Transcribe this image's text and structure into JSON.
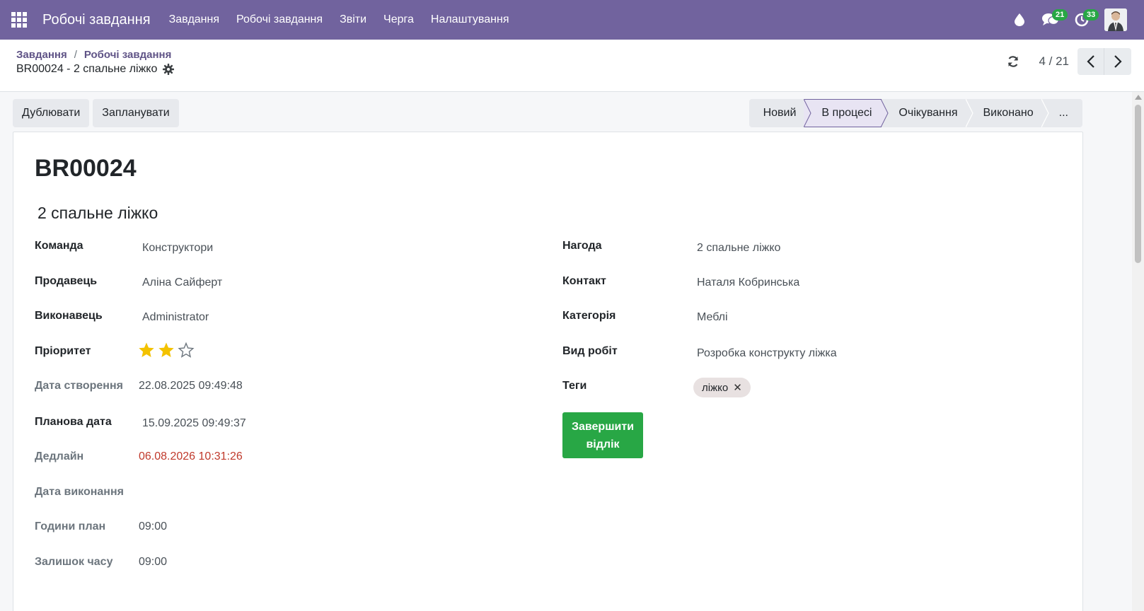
{
  "navbar": {
    "brand": "Робочі завдання",
    "menu": [
      {
        "label": "Завдання"
      },
      {
        "label": "Робочі завдання"
      },
      {
        "label": "Звіти"
      },
      {
        "label": "Черга"
      },
      {
        "label": "Налаштування"
      }
    ],
    "systray": {
      "messages_count": "21",
      "activities_count": "33"
    },
    "color": "#71639e"
  },
  "breadcrumb": {
    "items": [
      "Завдання",
      "Робочі завдання"
    ],
    "separator": "/",
    "current": "BR00024 - 2 спальне ліжко"
  },
  "pager": {
    "value": "4 / 21"
  },
  "actions": {
    "duplicate": "Дублювати",
    "schedule": "Запланувати"
  },
  "statusbar": {
    "stages": [
      {
        "label": "Новий",
        "active": false
      },
      {
        "label": "В процесі",
        "active": true
      },
      {
        "label": "Очікування",
        "active": false
      },
      {
        "label": "Виконано",
        "active": false
      },
      {
        "label": "...",
        "active": false
      }
    ]
  },
  "record": {
    "reference": "BR00024",
    "name": "2 спальне ліжко"
  },
  "fields_left": {
    "team": {
      "label": "Команда",
      "value": "Конструктори"
    },
    "salesperson": {
      "label": "Продавець",
      "value": "Аліна Сайферт"
    },
    "assignee": {
      "label": "Виконавець",
      "value": "Administrator"
    },
    "priority": {
      "label": "Пріоритет",
      "value": 2,
      "max": 3
    },
    "create_date": {
      "label": "Дата створення",
      "value": "22.08.2025 09:49:48"
    },
    "planned_date": {
      "label": "Планова дата",
      "value": "15.09.2025 09:49:37"
    },
    "deadline": {
      "label": "Дедлайн",
      "value": "06.08.2026 10:31:26"
    },
    "done_date": {
      "label": "Дата виконання",
      "value": ""
    },
    "planned_hours": {
      "label": "Години план",
      "value": "09:00"
    },
    "remaining_hours": {
      "label": "Залишок часу",
      "value": "09:00"
    }
  },
  "fields_right": {
    "opportunity": {
      "label": "Нагода",
      "value": "2 спальне ліжко"
    },
    "contact": {
      "label": "Контакт",
      "value": "Наталя Кобринська"
    },
    "category": {
      "label": "Категорія",
      "value": "Меблі"
    },
    "work_type": {
      "label": "Вид робіт",
      "value": "Розробка конструкту ліжка"
    },
    "tags": {
      "label": "Теги",
      "items": [
        "ліжко"
      ]
    },
    "finish_button": "Завершити відлік"
  },
  "colors": {
    "accent": "#71639e",
    "success": "#28a745",
    "danger": "#c0392b",
    "star": "#f3c200"
  }
}
